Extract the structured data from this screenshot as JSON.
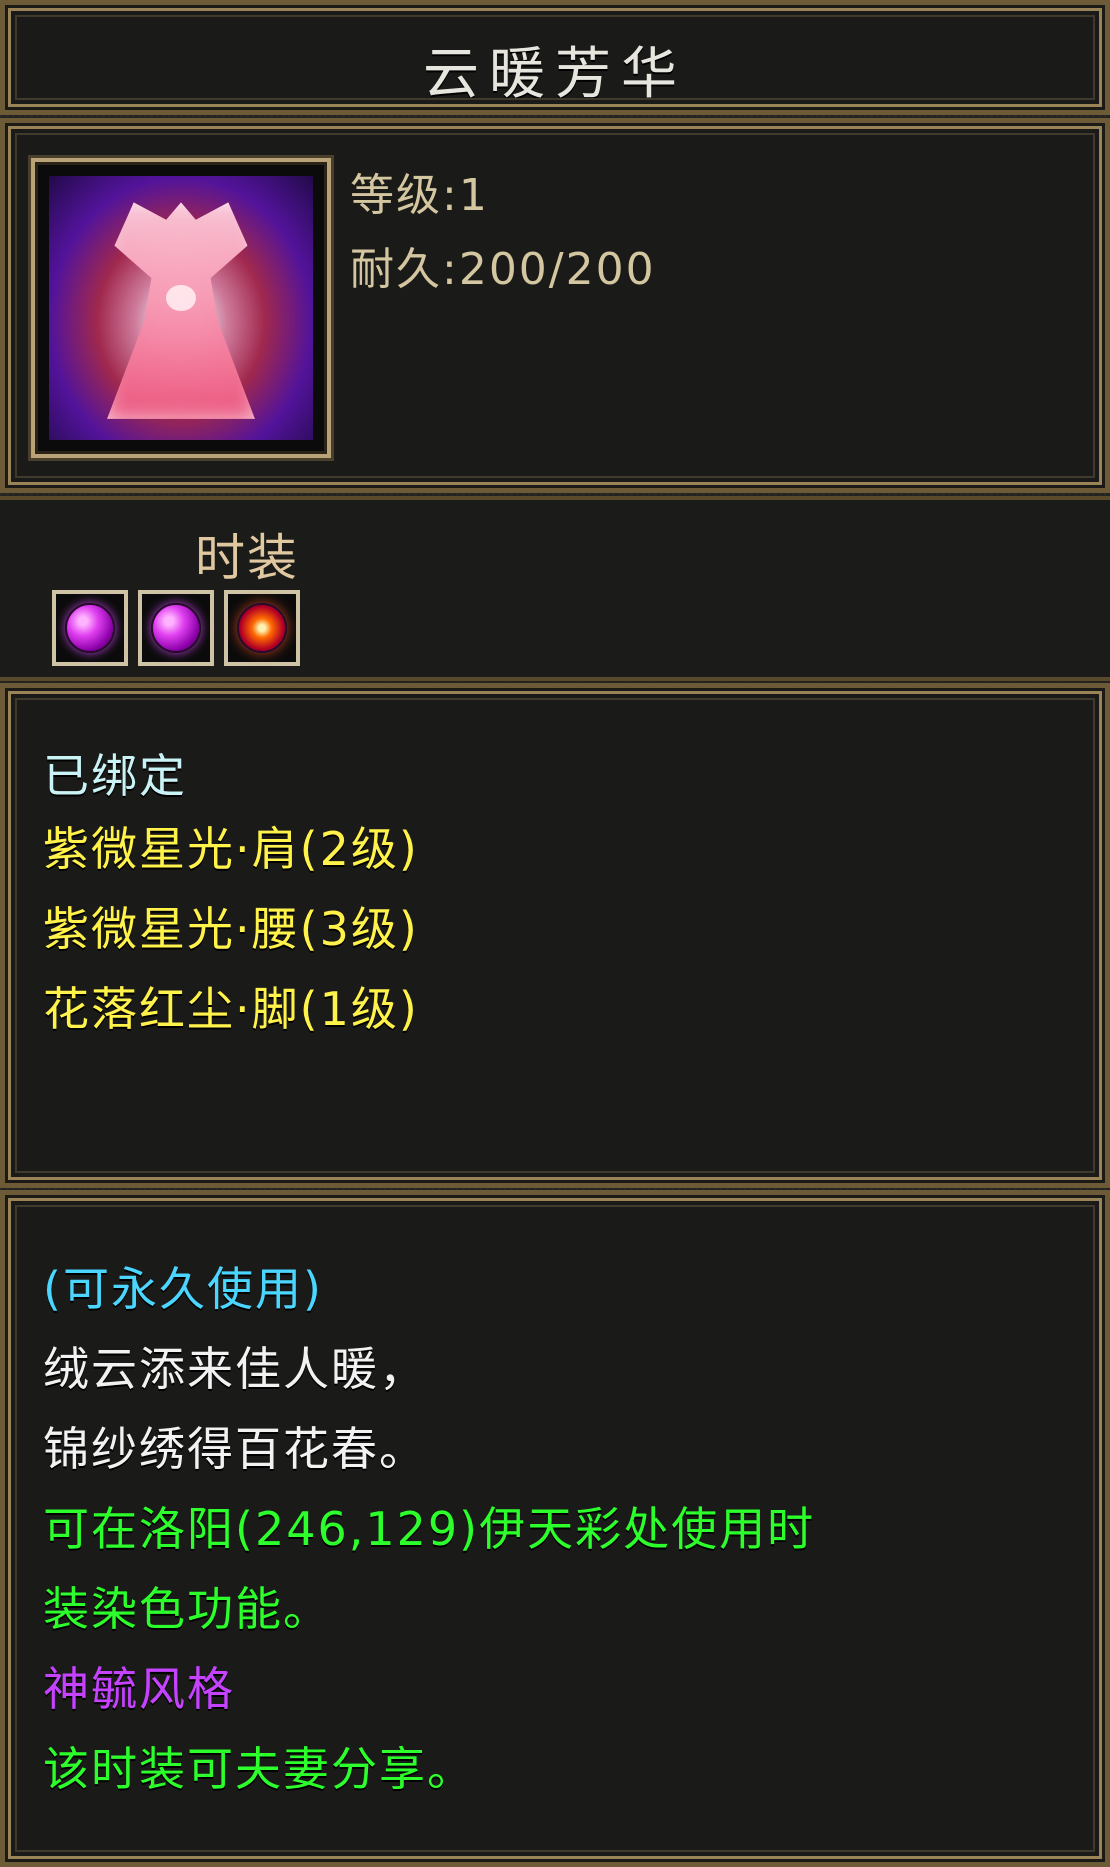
{
  "title": "云暖芳华",
  "item": {
    "icon": "pink-dress-icon",
    "level_text": "等级:1",
    "durability_text": "耐久:200/200"
  },
  "category": {
    "label": "时装",
    "slots": [
      "purple-gem-icon",
      "purple-gem-icon",
      "fire-gem-icon"
    ]
  },
  "bind": {
    "status": "已绑定",
    "sets": [
      "紫微星光·肩(2级)",
      "紫微星光·腰(3级)",
      "花落红尘·脚(1级)"
    ]
  },
  "description": {
    "usage": "(可永久使用)",
    "poem": [
      "绒云添来佳人暖，",
      "锦纱绣得百花春。"
    ],
    "feature_lines": [
      "可在洛阳(246,129)伊天彩处使用时",
      "装染色功能。"
    ],
    "style": "神毓风格",
    "share": "该时装可夫妻分享。"
  },
  "colors": {
    "frame_gold": "#9a8457",
    "bound_cyan": "#c9f3f5",
    "set_yellow": "#fff24a",
    "usage_blue": "#4bd6ff",
    "poem_white": "#f2f2f2",
    "feature_green": "#2cff2c",
    "style_purple": "#c542ff"
  }
}
